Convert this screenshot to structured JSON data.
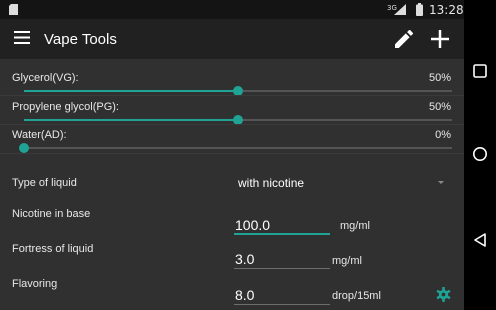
{
  "statusbar": {
    "network": "3G",
    "time": "13:28",
    "icons": [
      "sd-card-icon",
      "signal-icon",
      "battery-icon"
    ]
  },
  "appbar": {
    "title": "Vape Tools",
    "icons": [
      "menu-icon",
      "edit-icon",
      "add-icon"
    ]
  },
  "sliders": [
    {
      "label": "Glycerol(VG):",
      "value_text": "50%",
      "value": 50
    },
    {
      "label": "Propylene glycol(PG):",
      "value_text": "50%",
      "value": 50
    },
    {
      "label": "Water(AD):",
      "value_text": "0%",
      "value": 0
    }
  ],
  "form": {
    "liquid_type_label": "Type of liquid",
    "liquid_type_value": "with nicotine",
    "nicotine_label": "Nicotine in base",
    "nicotine_value": "100.0",
    "nicotine_unit": "mg/ml",
    "fortress_label": "Fortress of liquid",
    "fortress_value": "3.0",
    "fortress_unit": "mg/ml",
    "flavoring_label": "Flavoring",
    "flavoring_value": "8.0",
    "flavoring_unit": "drop/15ml"
  },
  "navbar": {
    "icons": [
      "recents-icon",
      "home-icon",
      "back-icon"
    ]
  },
  "colors": {
    "accent": "#1fa395",
    "appbar": "#212121",
    "background": "#303030",
    "statusbar": "#141414"
  }
}
